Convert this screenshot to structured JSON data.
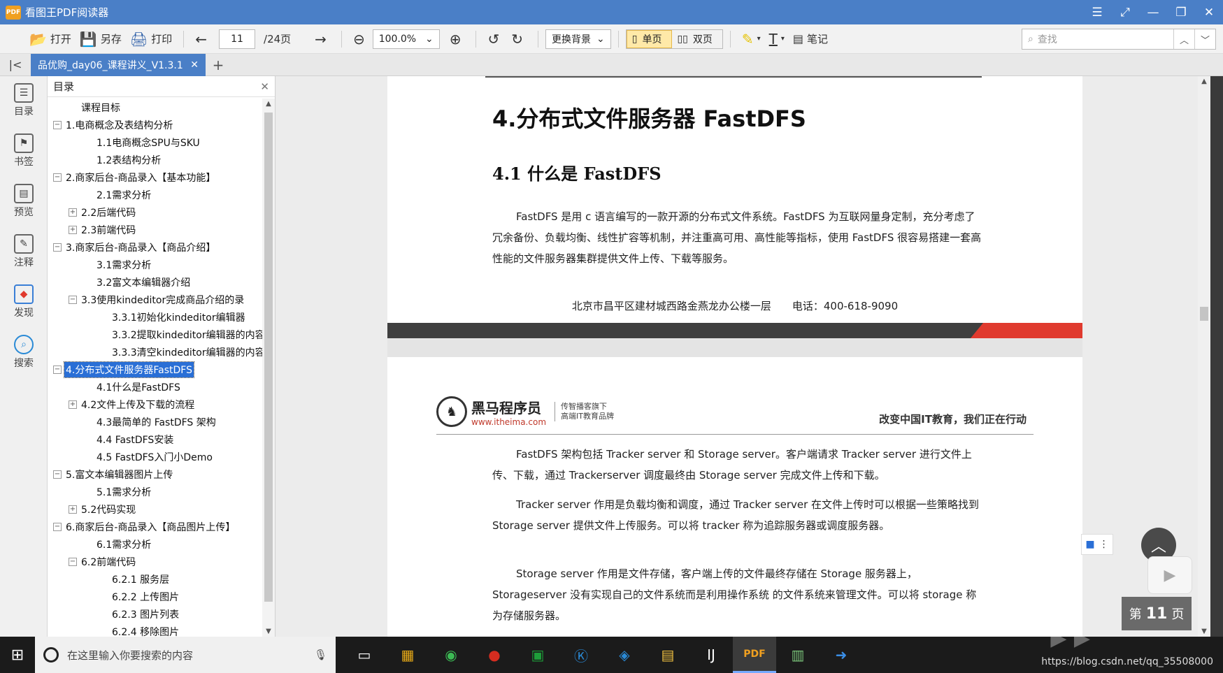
{
  "window": {
    "title": "看图王PDF阅读器",
    "app_icon_text": "PDF"
  },
  "toolbar": {
    "open_label": "打开",
    "save_label": "另存",
    "print_label": "打印",
    "page_current": "11",
    "page_total": "/24页",
    "zoom": "100.0%",
    "background_label": "更换背景",
    "single_page_label": "单页",
    "double_page_label": "双页",
    "notes_label": "笔记",
    "search_placeholder": "查找"
  },
  "tabs": {
    "document_tab": "品优购_day06_课程讲义_V1.3.1"
  },
  "rail": {
    "items": [
      {
        "label": "目录",
        "icon": "list-icon"
      },
      {
        "label": "书签",
        "icon": "bookmark-icon"
      },
      {
        "label": "预览",
        "icon": "preview-icon"
      },
      {
        "label": "注释",
        "icon": "annotation-icon"
      },
      {
        "label": "发现",
        "icon": "discover-icon"
      },
      {
        "label": "搜索",
        "icon": "search-icon"
      }
    ]
  },
  "toc": {
    "title": "目录",
    "items": [
      {
        "level": 1,
        "toggle": "",
        "label": "课程目标"
      },
      {
        "level": 0,
        "toggle": "−",
        "label": "1.电商概念及表结构分析"
      },
      {
        "level": 2,
        "toggle": "",
        "label": "1.1电商概念SPU与SKU"
      },
      {
        "level": 2,
        "toggle": "",
        "label": "1.2表结构分析"
      },
      {
        "level": 0,
        "toggle": "−",
        "label": "2.商家后台-商品录入【基本功能】"
      },
      {
        "level": 2,
        "toggle": "",
        "label": "2.1需求分析"
      },
      {
        "level": 1,
        "toggle": "+",
        "label": "2.2后端代码"
      },
      {
        "level": 1,
        "toggle": "+",
        "label": "2.3前端代码"
      },
      {
        "level": 0,
        "toggle": "−",
        "label": "3.商家后台-商品录入【商品介绍】"
      },
      {
        "level": 2,
        "toggle": "",
        "label": "3.1需求分析"
      },
      {
        "level": 2,
        "toggle": "",
        "label": "3.2富文本编辑器介绍"
      },
      {
        "level": 1,
        "toggle": "−",
        "label": "3.3使用kindeditor完成商品介绍的录"
      },
      {
        "level": 3,
        "toggle": "",
        "label": "3.3.1初始化kindeditor编辑器"
      },
      {
        "level": 3,
        "toggle": "",
        "label": "3.3.2提取kindeditor编辑器的内容"
      },
      {
        "level": 3,
        "toggle": "",
        "label": "3.3.3清空kindeditor编辑器的内容"
      },
      {
        "level": 0,
        "toggle": "−",
        "label": "4.分布式文件服务器FastDFS",
        "selected": true
      },
      {
        "level": 2,
        "toggle": "",
        "label": "4.1什么是FastDFS"
      },
      {
        "level": 1,
        "toggle": "+",
        "label": "4.2文件上传及下载的流程"
      },
      {
        "level": 2,
        "toggle": "",
        "label": "4.3最简单的 FastDFS 架构"
      },
      {
        "level": 2,
        "toggle": "",
        "label": "4.4 FastDFS安装"
      },
      {
        "level": 2,
        "toggle": "",
        "label": "4.5 FastDFS入门小Demo"
      },
      {
        "level": 0,
        "toggle": "−",
        "label": "5.富文本编辑器图片上传"
      },
      {
        "level": 2,
        "toggle": "",
        "label": "5.1需求分析"
      },
      {
        "level": 1,
        "toggle": "+",
        "label": "5.2代码实现"
      },
      {
        "level": 0,
        "toggle": "−",
        "label": "6.商家后台-商品录入【商品图片上传】"
      },
      {
        "level": 2,
        "toggle": "",
        "label": "6.1需求分析"
      },
      {
        "level": 1,
        "toggle": "−",
        "label": "6.2前端代码"
      },
      {
        "level": 3,
        "toggle": "",
        "label": "6.2.1 服务层"
      },
      {
        "level": 3,
        "toggle": "",
        "label": "6.2.2 上传图片"
      },
      {
        "level": 3,
        "toggle": "",
        "label": "6.2.3 图片列表"
      },
      {
        "level": 3,
        "toggle": "",
        "label": "6.2.4 移除图片"
      }
    ]
  },
  "document": {
    "h1": "4.分布式文件服务器 FastDFS",
    "h2": "4.1 什么是 FastDFS",
    "p1": "FastDFS 是用 c 语言编写的一款开源的分布式文件系统。FastDFS 为互联网量身定制，充分考虑了冗余备份、负载均衡、线性扩容等机制，并注重高可用、高性能等指标，使用 FastDFS 很容易搭建一套高性能的文件服务器集群提供文件上传、下载等服务。",
    "footer_address": "北京市昌平区建材城西路金燕龙办公楼一层　　电话：400-618-9090",
    "logo_brand": "黑马程序员",
    "logo_url": "www.itheima.com",
    "logo_tag1": "传智播客旗下",
    "logo_tag2": "高端IT教育品牌",
    "slogan": "改变中国IT教育，我们正在行动",
    "p2": "FastDFS 架构包括 Tracker server 和 Storage server。客户端请求 Tracker server 进行文件上传、下载，通过 Trackerserver 调度最终由 Storage server 完成文件上传和下载。",
    "p3": "Tracker server 作用是负载均衡和调度，通过 Tracker server 在文件上传时可以根据一些策略找到 Storage server 提供文件上传服务。可以将 tracker 称为追踪服务器或调度服务器。",
    "p4": "Storage server 作用是文件存储，客户端上传的文件最终存储在 Storage 服务器上，Storageserver 没有实现自己的文件系统而是利用操作系统 的文件系统来管理文件。可以将 storage 称为存储服务器。"
  },
  "overlay": {
    "page_indicator_prefix": "第",
    "page_indicator_num": "11",
    "page_indicator_suffix": "页"
  },
  "taskbar": {
    "search_placeholder": "在这里输入你要搜索的内容",
    "watermark": "https://blog.csdn.net/qq_35508000"
  }
}
